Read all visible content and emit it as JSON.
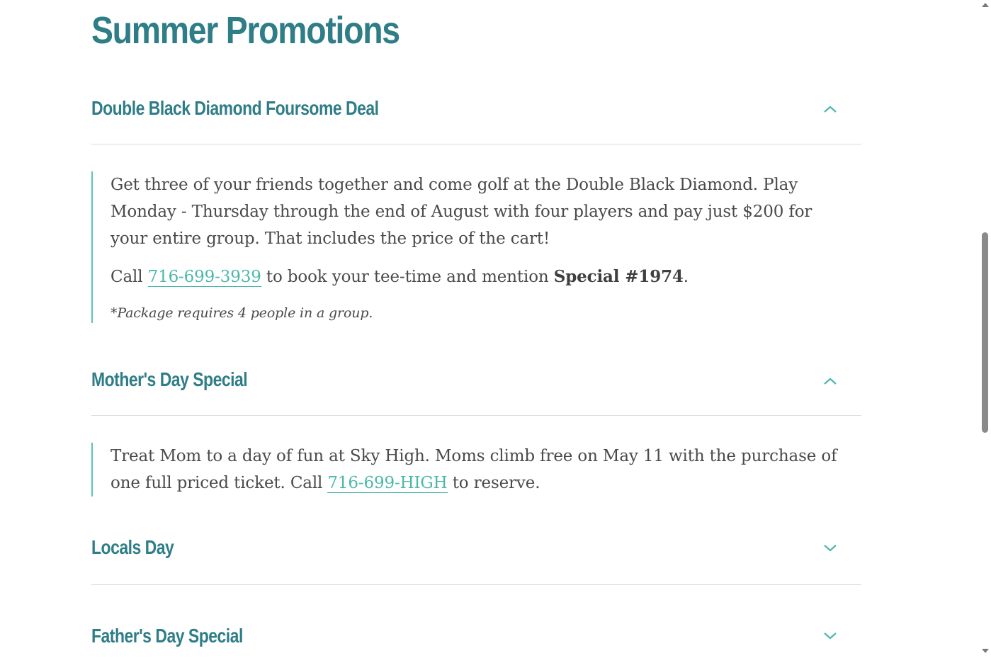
{
  "page": {
    "title": "Summer Promotions"
  },
  "accordion": [
    {
      "title": "Double Black Diamond Foursome Deal",
      "state": "expanded",
      "icon": "chevron-up-icon",
      "paragraph1": "Get three of your friends together and come golf at the Double Black Diamond. Play Monday - Thursday through the end of August with four players and pay just $200 for your entire group. That includes the price of the cart!",
      "call_prefix": "Call",
      "phone": "716-699-3939",
      "call_middle": "to book your tee-time and mention",
      "special": "Special #1974",
      "call_suffix": ".",
      "note": "*Package requires 4 people in a group."
    },
    {
      "title": "Mother's Day Special",
      "state": "expanded",
      "icon": "chevron-up-icon",
      "text_prefix": "Treat Mom to a day of fun at Sky High. Moms climb free on May 11 with the purchase of one full priced ticket. Call",
      "phone": "716-699-HIGH",
      "text_suffix": "to reserve."
    },
    {
      "title": "Locals Day",
      "state": "collapsed",
      "icon": "chevron-down-icon"
    },
    {
      "title": "Father's Day Special",
      "state": "collapsed",
      "icon": "chevron-down-icon"
    }
  ],
  "colors": {
    "heading": "#2e7d87",
    "accent": "#4bb8a9",
    "body_text": "#4a4a4a",
    "divider": "#dcdcdc"
  }
}
